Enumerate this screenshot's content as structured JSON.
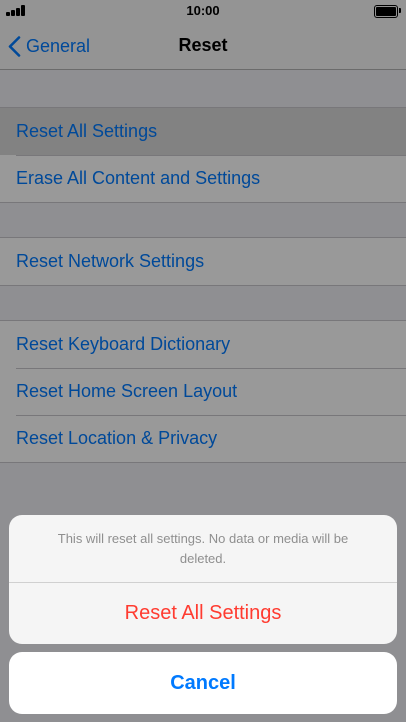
{
  "status_bar": {
    "time": "10:00",
    "signal_icon": "cellular-signal-icon",
    "battery_icon": "battery-icon",
    "battery_level": 1.0
  },
  "nav": {
    "back_label": "General",
    "back_icon": "chevron-left-icon",
    "title": "Reset"
  },
  "groups": [
    {
      "items": [
        {
          "label": "Reset All Settings",
          "highlighted": true
        },
        {
          "label": "Erase All Content and Settings",
          "highlighted": false
        }
      ]
    },
    {
      "items": [
        {
          "label": "Reset Network Settings",
          "highlighted": false
        }
      ]
    },
    {
      "items": [
        {
          "label": "Reset Keyboard Dictionary",
          "highlighted": false
        },
        {
          "label": "Reset Home Screen Layout",
          "highlighted": false
        },
        {
          "label": "Reset Location & Privacy",
          "highlighted": false
        }
      ]
    }
  ],
  "action_sheet": {
    "message": "This will reset all settings. No data or media will be deleted.",
    "destructive_label": "Reset All Settings",
    "cancel_label": "Cancel"
  },
  "colors": {
    "accent": "#007aff",
    "destructive": "#ff3b30",
    "background": "#efeff4"
  }
}
